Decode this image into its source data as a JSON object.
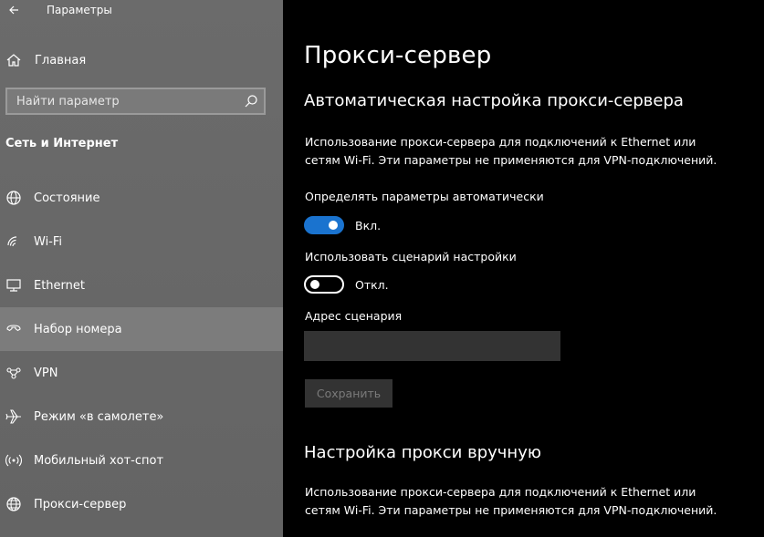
{
  "window": {
    "title": "Параметры"
  },
  "sidebar": {
    "home_label": "Главная",
    "search": {
      "placeholder": "Найти параметр"
    },
    "section_title": "Сеть и Интернет",
    "items": [
      {
        "label": "Состояние",
        "icon": "globe-network-icon"
      },
      {
        "label": "Wi-Fi",
        "icon": "wifi-icon"
      },
      {
        "label": "Ethernet",
        "icon": "ethernet-icon"
      },
      {
        "label": "Набор номера",
        "icon": "dialup-phone-icon",
        "selected": true
      },
      {
        "label": "VPN",
        "icon": "vpn-icon"
      },
      {
        "label": "Режим «в самолете»",
        "icon": "airplane-icon"
      },
      {
        "label": "Мобильный хот-спот",
        "icon": "hotspot-icon"
      },
      {
        "label": "Прокси-сервер",
        "icon": "globe-icon"
      }
    ]
  },
  "main": {
    "page_title": "Прокси-сервер",
    "auto_section": {
      "heading": "Автоматическая настройка прокси-сервера",
      "description_line1": "Использование прокси-сервера для подключений к Ethernet или",
      "description_line2": "сетям Wi-Fi. Эти параметры не применяются для VPN-подключений.",
      "detect_label": "Определять параметры автоматически",
      "detect_state": "Вкл.",
      "script_label": "Использовать сценарий настройки",
      "script_state": "Откл.",
      "address_label": "Адрес сценария",
      "address_value": "",
      "save_label": "Сохранить"
    },
    "manual_section": {
      "heading": "Настройка прокси вручную",
      "description_line1": "Использование прокси-сервера для подключений к Ethernet или",
      "description_line2": "сетям Wi-Fi. Эти параметры не применяются для VPN-подключений."
    }
  },
  "colors": {
    "accent": "#1a73cf",
    "sidebar_bg": "#6a6a6a",
    "main_bg": "#000000"
  }
}
